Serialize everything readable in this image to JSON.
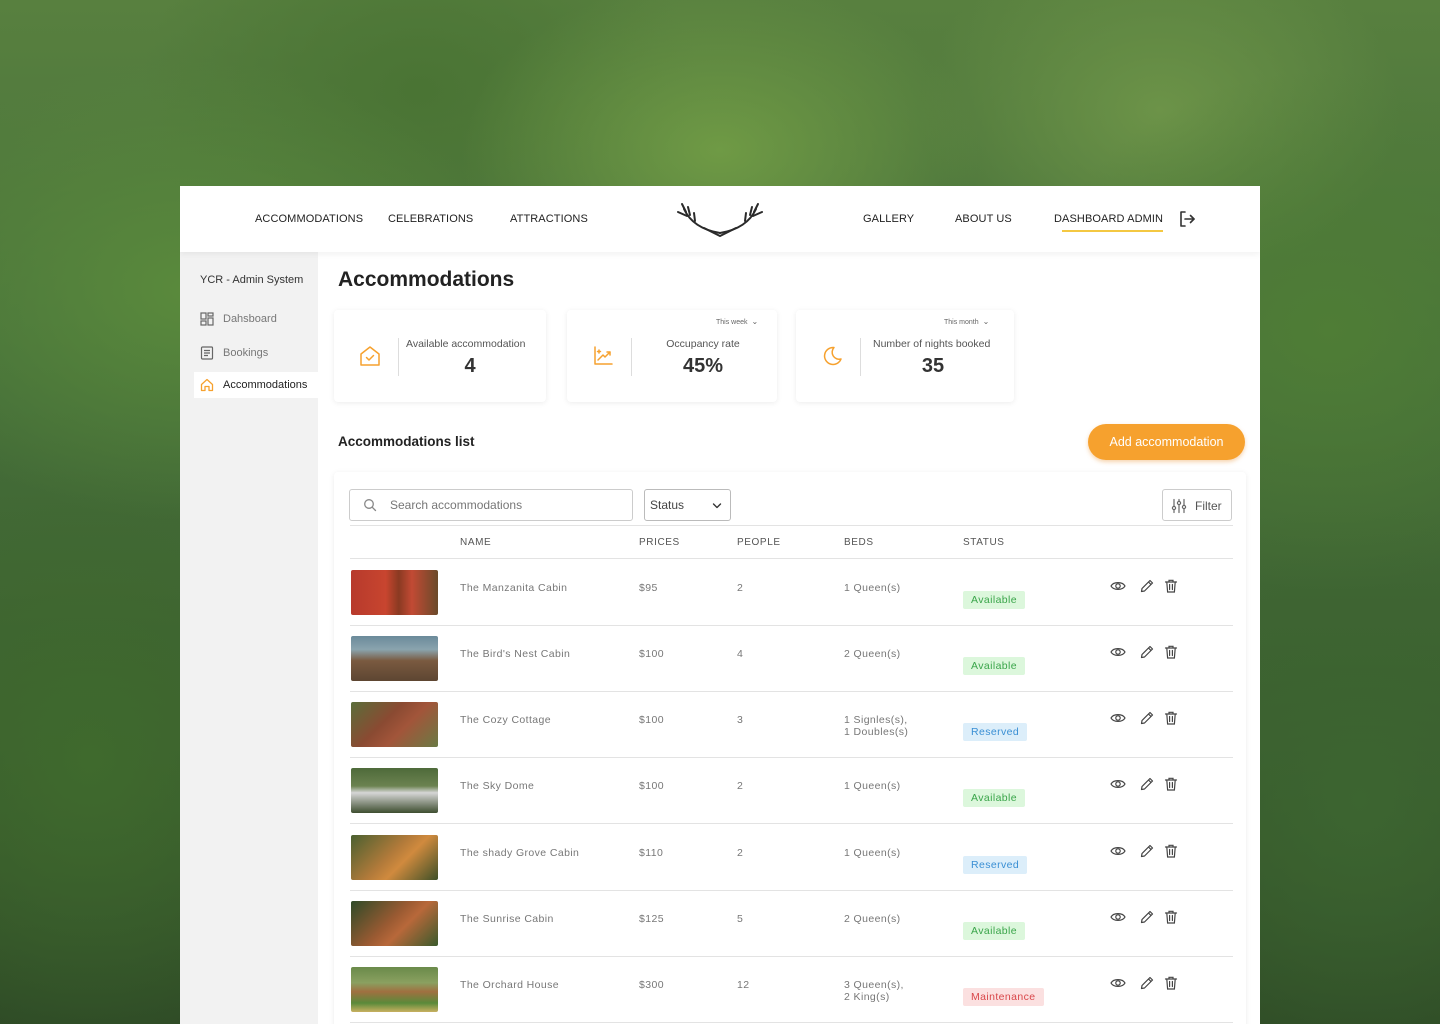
{
  "nav": {
    "left_links": [
      "ACCOMMODATIONS",
      "CELEBRATIONS",
      "ATTRACTIONS"
    ],
    "right_links": [
      "GALLERY",
      "ABOUT US",
      "DASHBOARD ADMIN"
    ],
    "active": "DASHBOARD ADMIN"
  },
  "sidebar": {
    "title": "YCR - Admin System",
    "items": [
      {
        "label": "Dahsboard",
        "icon": "grid-icon"
      },
      {
        "label": "Bookings",
        "icon": "document-icon"
      },
      {
        "label": "Accommodations",
        "icon": "home-icon"
      }
    ],
    "active": "Accommodations"
  },
  "page": {
    "title": "Accommodations"
  },
  "stats": [
    {
      "label": "Available accommodation",
      "value": "4",
      "period": "",
      "icon": "house-check-icon"
    },
    {
      "label": "Occupancy rate",
      "value": "45%",
      "period": "This week",
      "icon": "chart-growth-icon"
    },
    {
      "label": "Number of nights booked",
      "value": "35",
      "period": "This month",
      "icon": "moon-icon"
    }
  ],
  "list": {
    "title": "Accommodations list",
    "add_button": "Add accommodation",
    "search_placeholder": "Search accommodations",
    "status_select": "Status",
    "filter_label": "Filter",
    "columns": [
      "NAME",
      "PRICES",
      "PEOPLE",
      "BEDS",
      "STATUS"
    ],
    "rows": [
      {
        "name": "The Manzanita Cabin",
        "price": "$95",
        "people": "2",
        "beds": [
          "1 Queen(s)"
        ],
        "status": "Available"
      },
      {
        "name": "The Bird's Nest Cabin",
        "price": "$100",
        "people": "4",
        "beds": [
          "2 Queen(s)"
        ],
        "status": "Available"
      },
      {
        "name": "The Cozy Cottage",
        "price": "$100",
        "people": "3",
        "beds": [
          "1 Signles(s),",
          "1 Doubles(s)"
        ],
        "status": "Reserved"
      },
      {
        "name": "The Sky Dome",
        "price": "$100",
        "people": "2",
        "beds": [
          "1 Queen(s)"
        ],
        "status": "Available"
      },
      {
        "name": "The shady Grove Cabin",
        "price": "$110",
        "people": "2",
        "beds": [
          "1 Queen(s)"
        ],
        "status": "Reserved"
      },
      {
        "name": "The Sunrise Cabin",
        "price": "$125",
        "people": "5",
        "beds": [
          "2 Queen(s)"
        ],
        "status": "Available"
      },
      {
        "name": "The Orchard House",
        "price": "$300",
        "people": "12",
        "beds": [
          "3 Queen(s),",
          "2 King(s)"
        ],
        "status": "Maintenance"
      }
    ]
  },
  "colors": {
    "accent": "#f6a12e",
    "nav_underline": "#f4c842",
    "available": "#3aa54a",
    "reserved": "#3a8fd4",
    "maintenance": "#d9474a"
  }
}
